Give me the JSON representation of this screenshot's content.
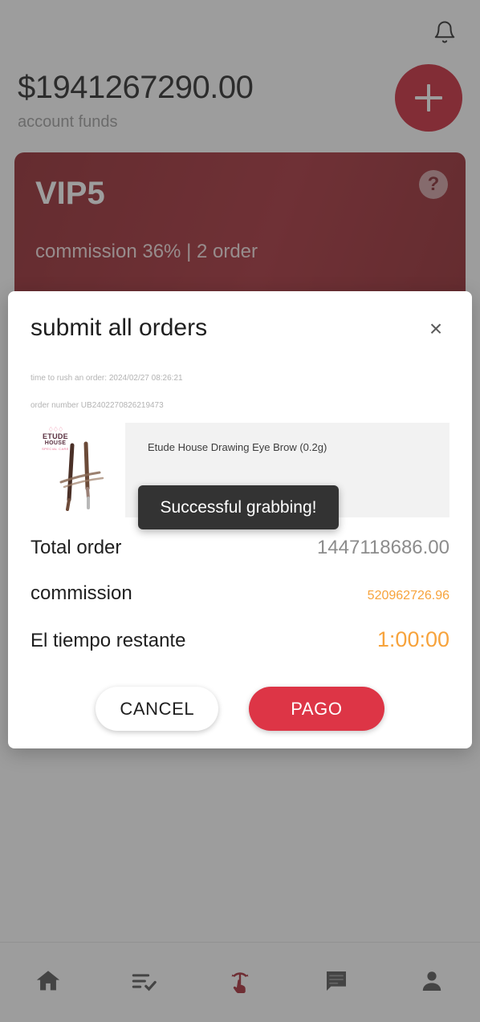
{
  "header": {
    "bell_icon": "notification-bell-icon",
    "balance_amount": "$1941267290.00",
    "balance_label": "account funds",
    "fab_icon": "plus-icon"
  },
  "vip_card": {
    "level": "VIP5",
    "details": "commission 36% | 2 order",
    "help_label": "?",
    "bg_color": "#9b2029"
  },
  "modal": {
    "title": "submit all orders",
    "close_label": "×",
    "time_line": "time to rush an order:  2024/02/27 08:26:21",
    "order_line": "order number UB2402270826219473",
    "product": {
      "name": "Etude House Drawing Eye Brow (0.2g)",
      "brand_crown": "♢♢♢",
      "brand_line1": "ETUDE",
      "brand_line2": "HOUSE",
      "brand_line3": "SPECIAL CARE"
    },
    "summary": [
      {
        "label": "Total order",
        "value": "1447118686.00",
        "style": "plain"
      },
      {
        "label": "commission",
        "value": "520962726.96",
        "style": "accent-small"
      },
      {
        "label": "El tiempo restante",
        "value": "1:00:00",
        "style": "accent-big"
      }
    ],
    "cancel_label": "CANCEL",
    "pay_label": "PAGO",
    "accent_orange": "#f7a33c",
    "pay_color": "#dd3546"
  },
  "toast": {
    "message": "Successful grabbing!"
  },
  "bottom_nav": {
    "items": [
      {
        "icon": "home-icon",
        "active": false
      },
      {
        "icon": "list-check-icon",
        "active": false
      },
      {
        "icon": "swipe-gesture-icon",
        "active": true
      },
      {
        "icon": "chat-icon",
        "active": false
      },
      {
        "icon": "person-icon",
        "active": false
      }
    ],
    "active_color": "#a3212c",
    "inactive_color": "#4d4d4d"
  }
}
